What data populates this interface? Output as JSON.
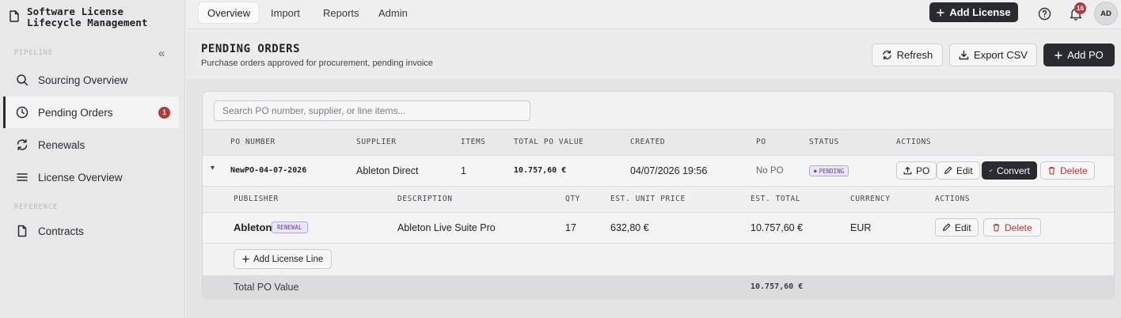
{
  "app": {
    "title_line1": "Software License",
    "title_line2": "Lifecycle Management"
  },
  "sidebar": {
    "sections": [
      {
        "label": "PIPELINE"
      },
      {
        "label": "REFERENCE"
      }
    ],
    "items": [
      {
        "label": "Sourcing Overview",
        "icon": "search-icon"
      },
      {
        "label": "Pending Orders",
        "icon": "clock-icon",
        "badge": "1"
      },
      {
        "label": "Renewals",
        "icon": "refresh-icon"
      },
      {
        "label": "License Overview",
        "icon": "list-icon"
      },
      {
        "label": "Contracts",
        "icon": "document-icon"
      }
    ]
  },
  "topbar": {
    "tabs": [
      {
        "label": "Overview"
      },
      {
        "label": "Import"
      },
      {
        "label": "Reports"
      },
      {
        "label": "Admin"
      }
    ],
    "add_license": "Add License",
    "notifications_count": "16",
    "avatar": "AD"
  },
  "page": {
    "title": "PENDING ORDERS",
    "subtitle": "Purchase orders approved for procurement, pending invoice",
    "refresh": "Refresh",
    "export_csv": "Export CSV",
    "add_po": "Add PO"
  },
  "search": {
    "placeholder": "Search PO number, supplier, or line items..."
  },
  "table": {
    "headers": [
      "PO NUMBER",
      "SUPPLIER",
      "ITEMS",
      "TOTAL PO VALUE",
      "CREATED",
      "PO",
      "STATUS",
      "ACTIONS"
    ],
    "row": {
      "po_number": "NewPO-04-07-2026",
      "supplier": "Ableton Direct",
      "items": "1",
      "total": "10.757,60 €",
      "created": "04/07/2026 19:56",
      "po": "No PO",
      "status": "PENDING",
      "actions": {
        "po": "PO",
        "edit": "Edit",
        "convert": "Convert",
        "delete": "Delete"
      }
    }
  },
  "lines": {
    "headers": [
      "PUBLISHER",
      "DESCRIPTION",
      "QTY",
      "EST. UNIT PRICE",
      "EST. TOTAL",
      "CURRENCY",
      "ACTIONS"
    ],
    "row": {
      "publisher": "Ableton",
      "tag": "RENEWAL",
      "description": "Ableton Live Suite Pro",
      "qty": "17",
      "unit_price": "632,80 €",
      "total": "10.757,60 €",
      "currency": "EUR",
      "actions": {
        "edit": "Edit",
        "delete": "Delete"
      }
    },
    "add_line": "Add License Line",
    "total_label": "Total PO Value",
    "total_value": "10.757,60 €"
  }
}
